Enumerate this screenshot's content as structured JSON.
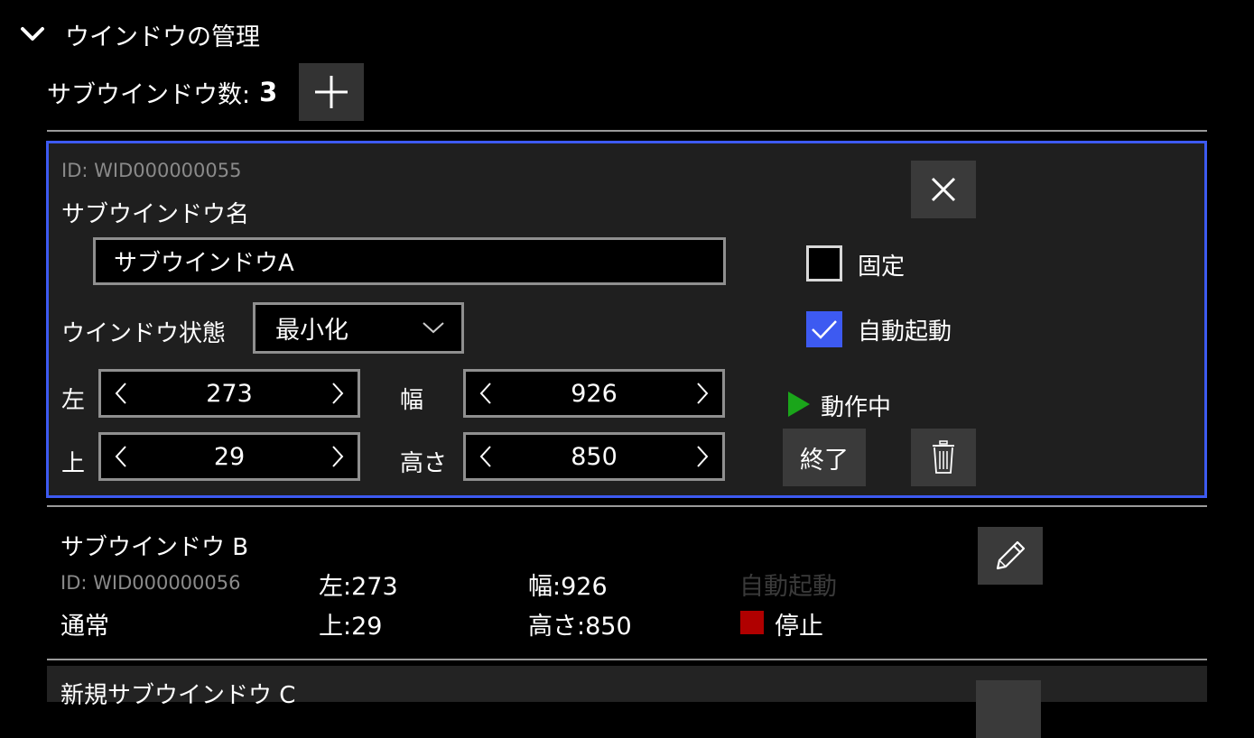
{
  "section": {
    "title": "ウインドウの管理"
  },
  "subwindow_count": {
    "label": "サブウインドウ数:",
    "value": "3"
  },
  "window_a": {
    "id": "ID: WID000000055",
    "name_label": "サブウインドウ名",
    "name_value": "サブウインドウA",
    "state_label": "ウインドウ状態",
    "state_value": "最小化",
    "left_label": "左",
    "left_value": "273",
    "top_label": "上",
    "top_value": "29",
    "width_label": "幅",
    "width_value": "926",
    "height_label": "高さ",
    "height_value": "850",
    "fixed_label": "固定",
    "fixed_checked": false,
    "autostart_label": "自動起動",
    "autostart_checked": true,
    "status_text": "動作中",
    "end_button": "終了"
  },
  "window_b": {
    "name": "サブウインドウ B",
    "id": "ID: WID000000056",
    "state": "通常",
    "left": "左:273",
    "top": "上:29",
    "width": "幅:926",
    "height": "高さ:850",
    "autostart": "自動起動",
    "status_text": "停止"
  },
  "window_c": {
    "name": "新規サブウインドウ C"
  },
  "colors": {
    "accent": "#3d5af1",
    "running": "#1aa51a",
    "stopped": "#b00000",
    "button_bg": "#3a3a3a"
  }
}
